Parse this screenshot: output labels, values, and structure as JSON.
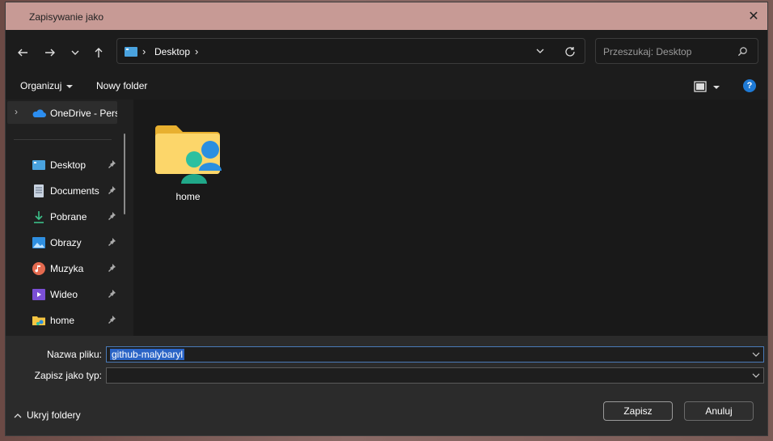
{
  "window": {
    "title": "Zapisywanie jako"
  },
  "address": {
    "crumb": "Desktop"
  },
  "search": {
    "placeholder": "Przeszukaj: Desktop"
  },
  "toolbar": {
    "organize": "Organizuj",
    "new_folder": "Nowy folder",
    "help": "?"
  },
  "sidebar": {
    "onedrive": "OneDrive - Perso",
    "items": [
      {
        "label": "Desktop",
        "icon": "desktop-icon"
      },
      {
        "label": "Documents",
        "icon": "documents-icon"
      },
      {
        "label": "Pobrane",
        "icon": "download-icon"
      },
      {
        "label": "Obrazy",
        "icon": "pictures-icon"
      },
      {
        "label": "Muzyka",
        "icon": "music-icon"
      },
      {
        "label": "Wideo",
        "icon": "video-icon"
      },
      {
        "label": "home",
        "icon": "home-folder-icon"
      }
    ]
  },
  "files": [
    {
      "name": "home"
    }
  ],
  "form": {
    "filename_label": "Nazwa pliku:",
    "filename_value": "github-malybaryl",
    "filetype_label": "Zapisz jako typ:",
    "filetype_value": ""
  },
  "footer": {
    "hide_folders": "Ukryj foldery",
    "save": "Zapisz",
    "cancel": "Anuluj"
  },
  "colors": {
    "titlebar": "#c79a95",
    "selection": "#2a64c6",
    "accent": "#1e7ad6"
  }
}
